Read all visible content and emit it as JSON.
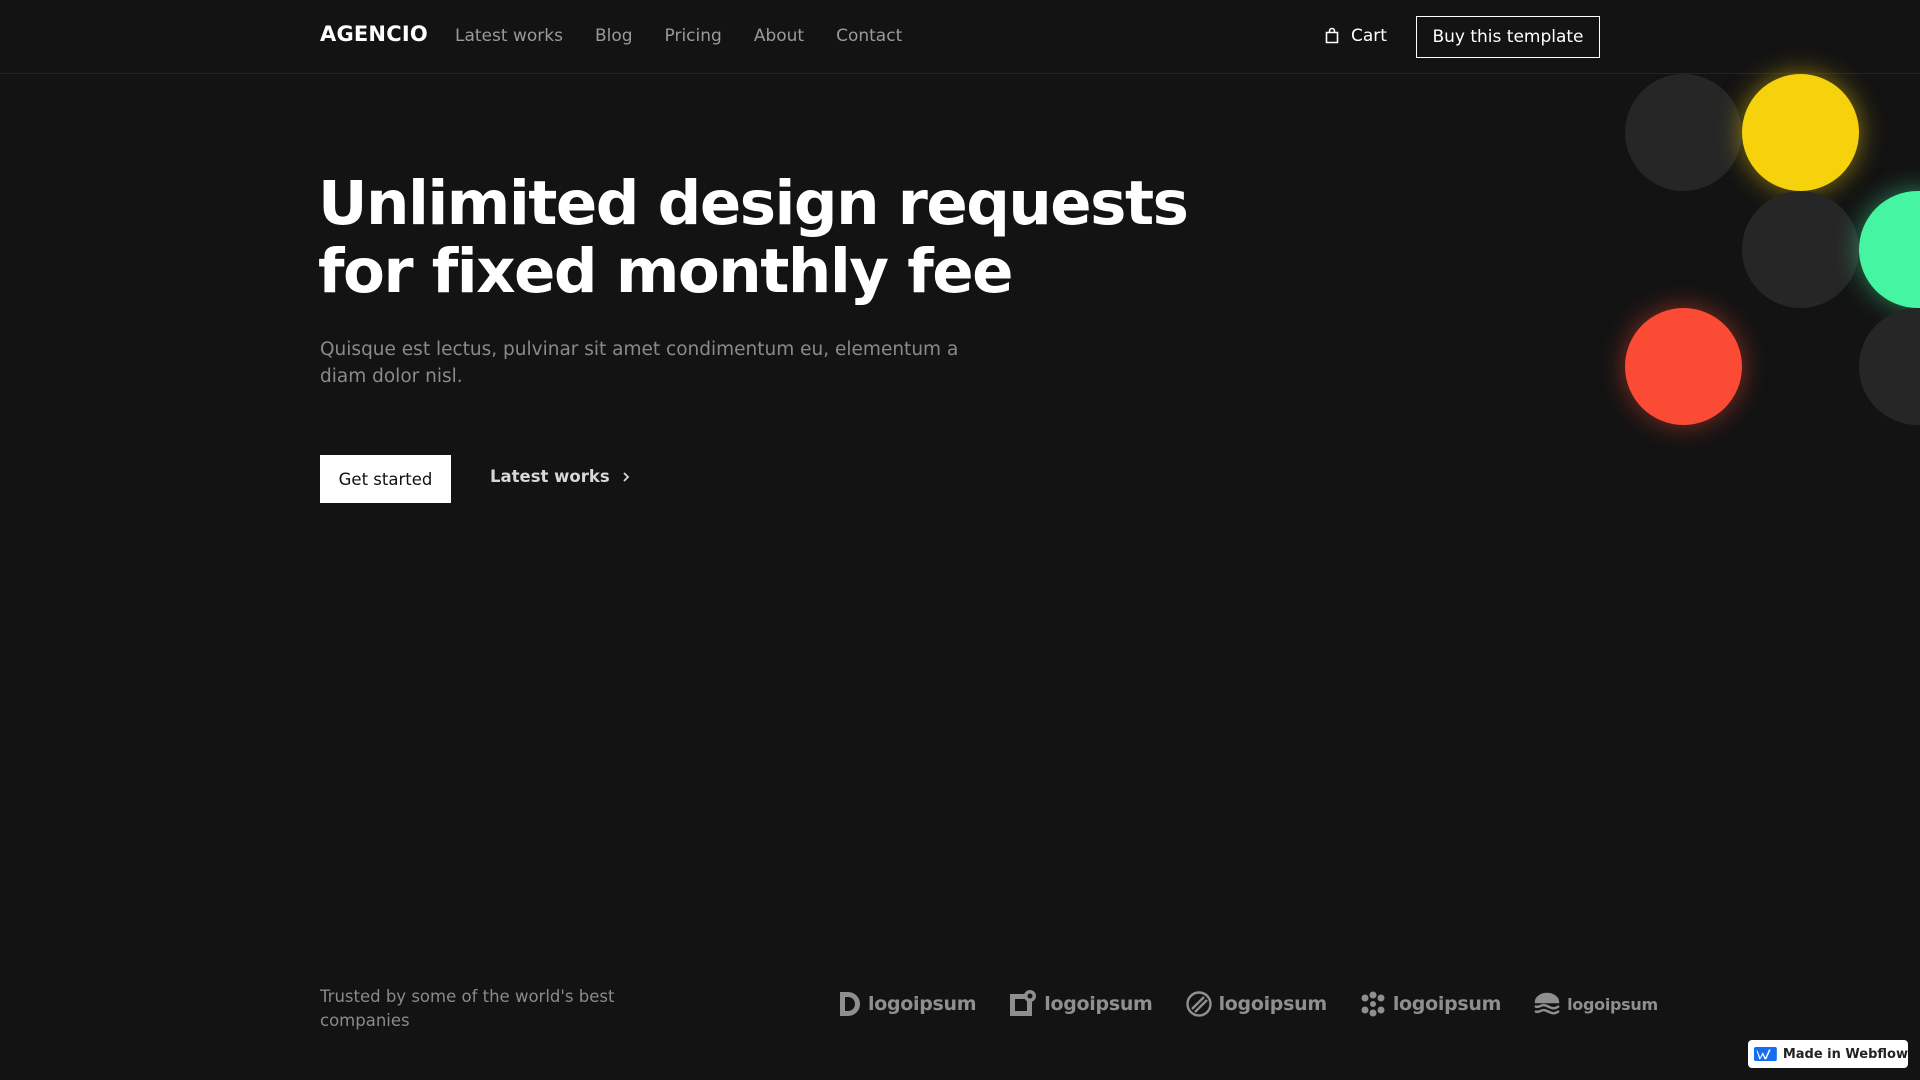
{
  "nav": {
    "brand": "AGENCIO",
    "links": [
      "Latest works",
      "Blog",
      "Pricing",
      "About",
      "Contact"
    ],
    "cart_label": "Cart",
    "cart_icon": "shopping-bag-icon",
    "buy_label": "Buy this template"
  },
  "hero": {
    "title_line1": "Unlimited design requests",
    "title_line2": "for fixed monthly fee",
    "subtitle": "Quisque est lectus, pulvinar sit amet condimentum eu, elementum a diam dolor nisl.",
    "primary_button": "Get started",
    "secondary_button": "Latest works",
    "secondary_icon": "chevron-right-icon"
  },
  "decor": {
    "colors": {
      "dark": "#262626",
      "yellow": "#f6d20c",
      "green": "#45f5a1",
      "red": "#fb4b34"
    }
  },
  "trusted": {
    "text": "Trusted by some of the world's best companies",
    "logos": [
      "logoipsum",
      "logoipsum",
      "logoipsum",
      "logoipsum",
      "logoipsum"
    ]
  },
  "badge": {
    "label": "Made in Webflow",
    "icon": "webflow-logo-icon"
  },
  "colors": {
    "background": "#131313",
    "text_primary": "#ffffff",
    "text_muted": "#8a8a8a"
  }
}
